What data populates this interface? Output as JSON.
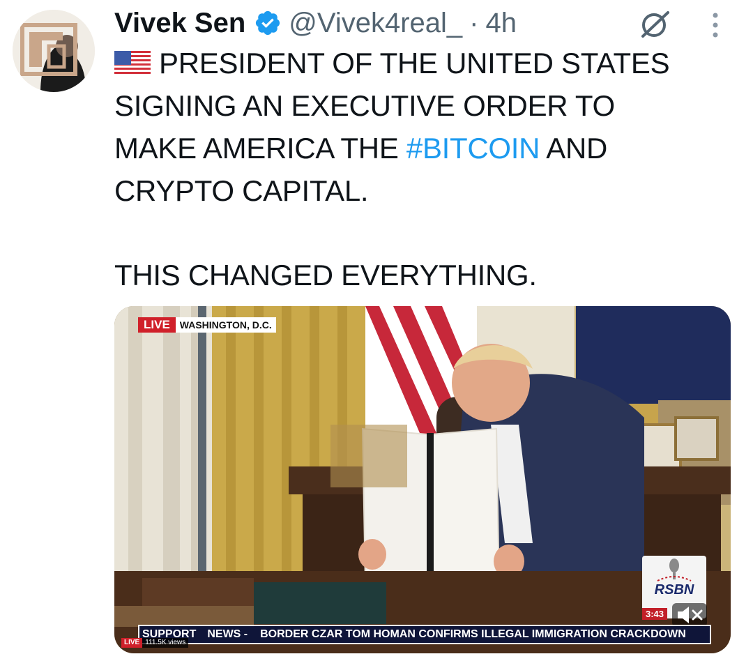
{
  "author": {
    "display_name": "Vivek Sen",
    "handle": "@Vivek4real_",
    "separator": "·",
    "time": "4h",
    "verified": true,
    "avatar_icon": "avatar-logo-icon"
  },
  "actions": {
    "grok_icon": "grok-icon",
    "more_icon": "more-vertical-icon"
  },
  "body": {
    "flag_icon": "us-flag-icon",
    "line1": "PRESIDENT OF THE UNITED STATES",
    "line2": "SIGNING AN EXECUTIVE ORDER TO",
    "line3_before": "MAKE AMERICA THE ",
    "hashtag": "#BITCOIN",
    "line3_after": " AND",
    "line4": "CRYPTO CAPITAL.",
    "closing": "THIS CHANGED EVERYTHING."
  },
  "video": {
    "live_label": "LIVE",
    "location": "WASHINGTON, D.C.",
    "network": "RSBN",
    "duration": "3:43",
    "ticker_left": "SUPPORT",
    "ticker_news": "NEWS -",
    "ticker_headline": "BORDER CZAR TOM HOMAN CONFIRMS ILLEGAL IMMIGRATION CRACKDOWN",
    "views_live": "LIVE",
    "views": "111.5K views",
    "mute_icon": "muted-speaker-icon"
  },
  "colors": {
    "link": "#1d9bf0",
    "verified": "#1d9bf0",
    "secondary_text": "#536471",
    "live_red": "#d0202a"
  }
}
